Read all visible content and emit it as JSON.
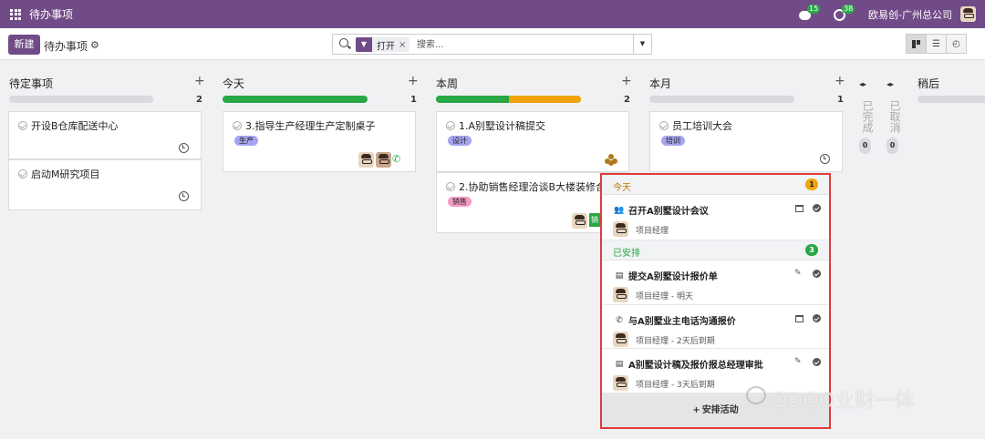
{
  "navbar": {
    "title": "待办事项",
    "chat_count": "15",
    "activity_count": "38",
    "company": "欧易创-广州总公司"
  },
  "control": {
    "new_label": "新建",
    "breadcrumb": "待办事项",
    "facet_label": "打开",
    "facet_close": "×",
    "search_placeholder": "搜索..."
  },
  "columns": [
    {
      "title": "待定事项",
      "count": "2",
      "cards": [
        {
          "title": "开设B仓库配送中心"
        },
        {
          "title": "启动M研究项目"
        }
      ]
    },
    {
      "title": "今天",
      "count": "1",
      "cards": [
        {
          "title": "3.指导生产经理生产定制桌子",
          "tag": "生产"
        }
      ]
    },
    {
      "title": "本周",
      "count": "2",
      "cards": [
        {
          "title": "1.A别墅设计稿提交",
          "tag": "设计"
        },
        {
          "title": "2.协助销售经理洽谈B大楼装修合",
          "tag": "销售",
          "badge": "销"
        }
      ]
    },
    {
      "title": "本月",
      "count": "1",
      "cards": [
        {
          "title": "员工培训大会",
          "tag": "培训"
        }
      ]
    },
    {
      "title": "稍后"
    }
  ],
  "folded": [
    {
      "label": "已完成",
      "count": "0"
    },
    {
      "label": "已取消",
      "count": "0"
    }
  ],
  "popover": {
    "today": {
      "title": "今天",
      "count": "1"
    },
    "planned": {
      "title": "已安排",
      "count": "3"
    },
    "items": [
      {
        "title": "召开A别墅设计会议",
        "sub": "项目经理"
      },
      {
        "title": "提交A别墅设计报价单",
        "sub": "项目经理 - 明天"
      },
      {
        "title": "与A别墅业主电话沟通报价",
        "sub": "项目经理 - 2天后到期"
      },
      {
        "title": "A别墅设计稿及报价报总经理审批",
        "sub": "项目经理 - 3天后到期"
      }
    ],
    "footer": "安排活动"
  },
  "watermark": "ODOO业财一体",
  "colors": {
    "brand": "#714b87",
    "green": "#28a745",
    "orange": "#f0a30a",
    "highlight": "#e13a3a"
  }
}
